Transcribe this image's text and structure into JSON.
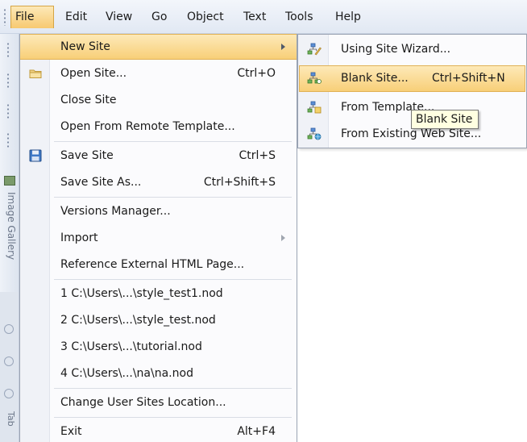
{
  "menubar": {
    "items": [
      {
        "label": "File"
      },
      {
        "label": "Edit"
      },
      {
        "label": "View"
      },
      {
        "label": "Go"
      },
      {
        "label": "Object"
      },
      {
        "label": "Text"
      },
      {
        "label": "Tools"
      },
      {
        "label": "Help"
      }
    ]
  },
  "left_strip": {
    "vertical_label": "Image Gallery",
    "bottom_label": "Tab"
  },
  "file_menu": {
    "items": [
      {
        "label": "New Site",
        "shortcut": ""
      },
      {
        "label": "Open Site...",
        "shortcut": "Ctrl+O"
      },
      {
        "label": "Close Site",
        "shortcut": ""
      },
      {
        "label": "Open From Remote Template...",
        "shortcut": ""
      },
      {
        "label": "Save Site",
        "shortcut": "Ctrl+S"
      },
      {
        "label": "Save Site As...",
        "shortcut": "Ctrl+Shift+S"
      },
      {
        "label": "Versions Manager...",
        "shortcut": ""
      },
      {
        "label": "Import",
        "shortcut": ""
      },
      {
        "label": "Reference External HTML Page...",
        "shortcut": ""
      },
      {
        "label": "1 C:\\Users\\...\\style_test1.nod",
        "shortcut": ""
      },
      {
        "label": "2 C:\\Users\\...\\style_test.nod",
        "shortcut": ""
      },
      {
        "label": "3 C:\\Users\\...\\tutorial.nod",
        "shortcut": ""
      },
      {
        "label": "4 C:\\Users\\...\\na\\na.nod",
        "shortcut": ""
      },
      {
        "label": "Change User Sites Location...",
        "shortcut": ""
      },
      {
        "label": "Exit",
        "shortcut": "Alt+F4"
      }
    ]
  },
  "new_site_submenu": {
    "items": [
      {
        "label": "Using Site Wizard...",
        "shortcut": ""
      },
      {
        "label": "Blank Site...",
        "shortcut": "Ctrl+Shift+N"
      },
      {
        "label": "From Template...",
        "shortcut": ""
      },
      {
        "label": "From Existing Web Site...",
        "shortcut": ""
      }
    ]
  },
  "tooltip": {
    "text": "Blank Site"
  },
  "colors": {
    "highlight_top": "#fde9b8",
    "highlight_bottom": "#f8cf78",
    "highlight_border": "#e0b155",
    "tooltip_bg": "#ffffe1"
  }
}
